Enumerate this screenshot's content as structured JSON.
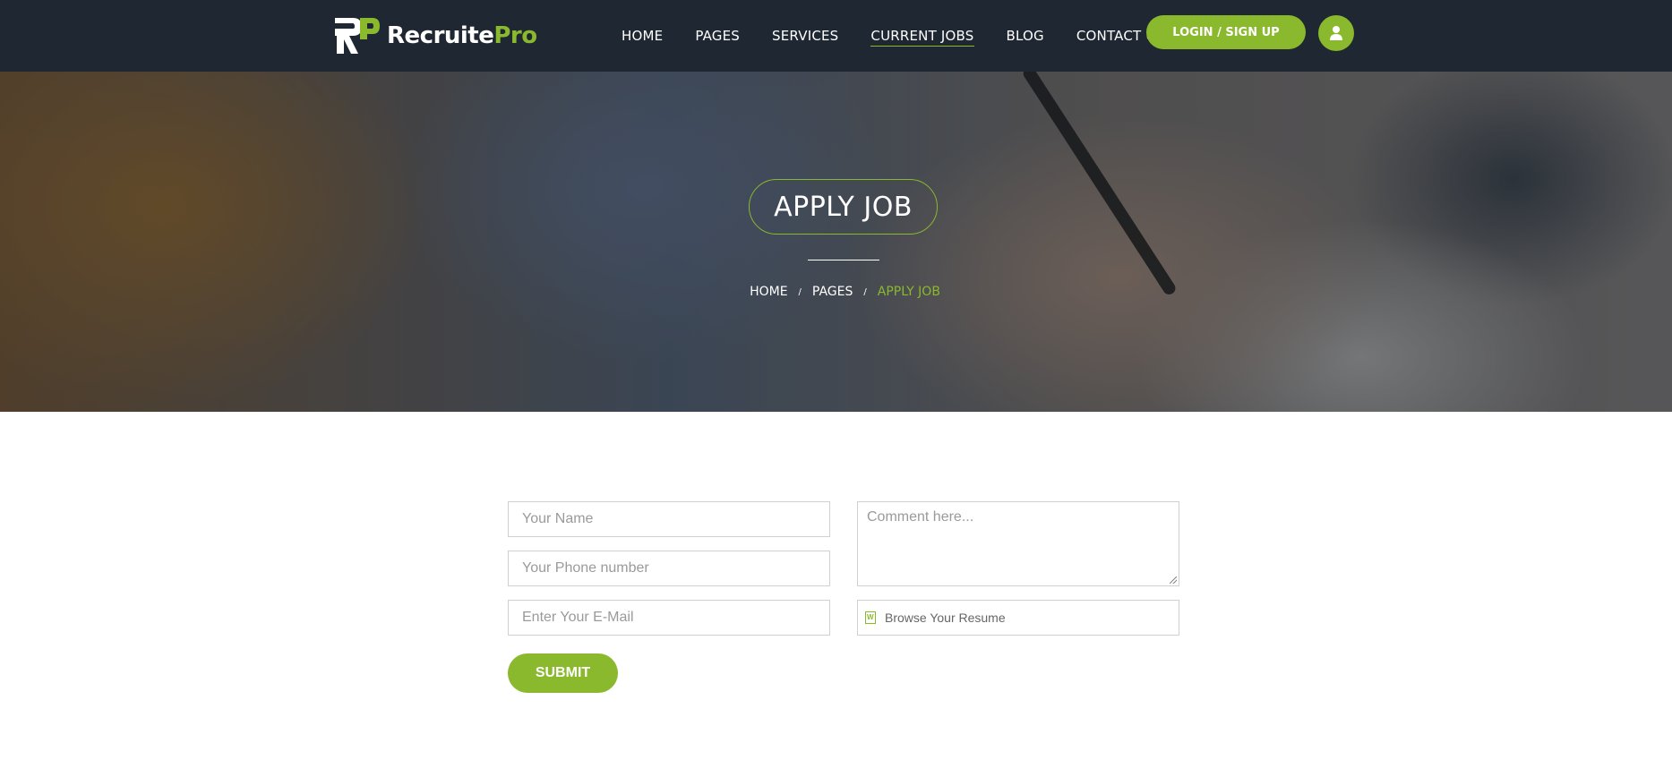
{
  "brand": {
    "name_part1": "Recruite",
    "name_part2": "Pro",
    "accent_color": "#8ab92d",
    "nav_bg": "#1e2732"
  },
  "nav": {
    "links": [
      "HOME",
      "PAGES",
      "SERVICES",
      "CURRENT JOBS",
      "BLOG",
      "CONTACT US"
    ],
    "active": "CURRENT JOBS",
    "login_label": "LOGIN / SIGN UP",
    "user_icon": "user-icon"
  },
  "hero": {
    "title": "APPLY JOB",
    "breadcrumb": [
      "HOME",
      "PAGES",
      "APPLY JOB"
    ],
    "separator": "/"
  },
  "form": {
    "name_placeholder": "Your Name",
    "phone_placeholder": "Your Phone number",
    "email_placeholder": "Enter Your E-Mail",
    "comment_placeholder": "Comment here...",
    "resume_label": "Browse Your Resume",
    "resume_icon": "word-document-icon",
    "submit_label": "SUBMIT"
  }
}
